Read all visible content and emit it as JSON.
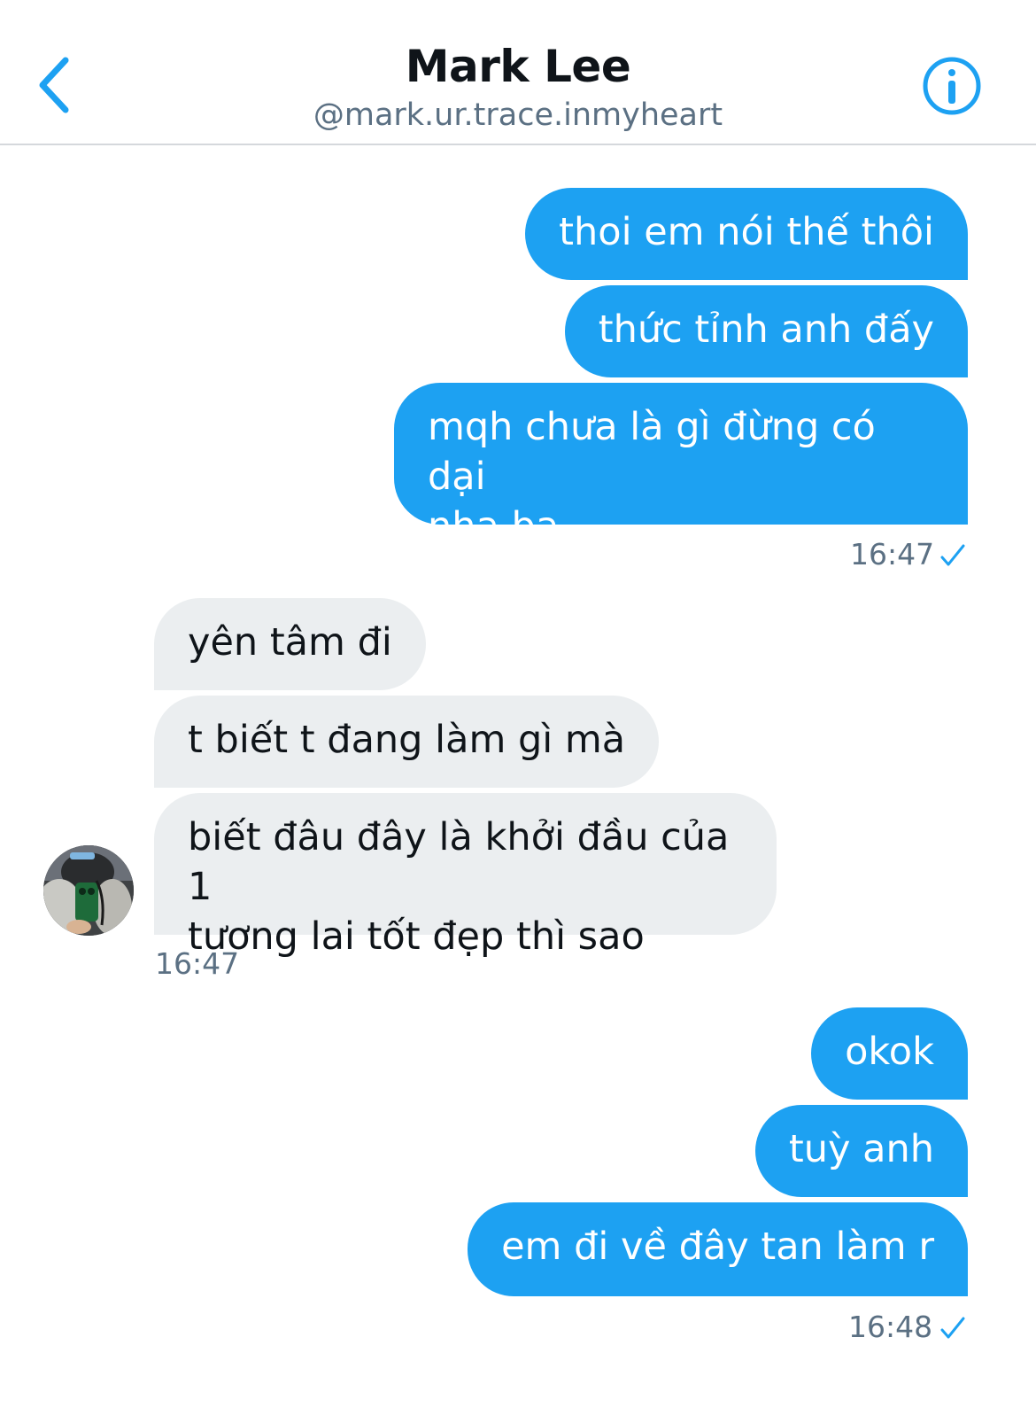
{
  "header": {
    "back_icon": "chevron-left-icon",
    "name": "Mark Lee",
    "handle": "@mark.ur.trace.inmyheart",
    "info_icon": "info-circle-icon"
  },
  "colors": {
    "accent": "#1da1f2",
    "incoming_bubble": "#ebeef0",
    "secondary_text": "#5b7083"
  },
  "conversation": {
    "group1": {
      "messages": [
        "thoi em nói thế thôi",
        "thức tỉnh anh đấy",
        "mqh chưa là gì đừng có dại\nnha ba"
      ],
      "time": "16:47",
      "status_icon": "checkmark-icon"
    },
    "group2": {
      "messages": [
        "yên tâm đi",
        "t biết t đang làm gì mà",
        "biết đâu đây là khởi đầu của 1\ntương lai tốt đẹp thì sao"
      ],
      "time": "16:47",
      "avatar_icon": "avatar-photo"
    },
    "group3": {
      "messages": [
        "okok",
        "tuỳ anh",
        "em đi về đây tan làm r"
      ],
      "time": "16:48",
      "status_icon": "checkmark-icon"
    }
  }
}
